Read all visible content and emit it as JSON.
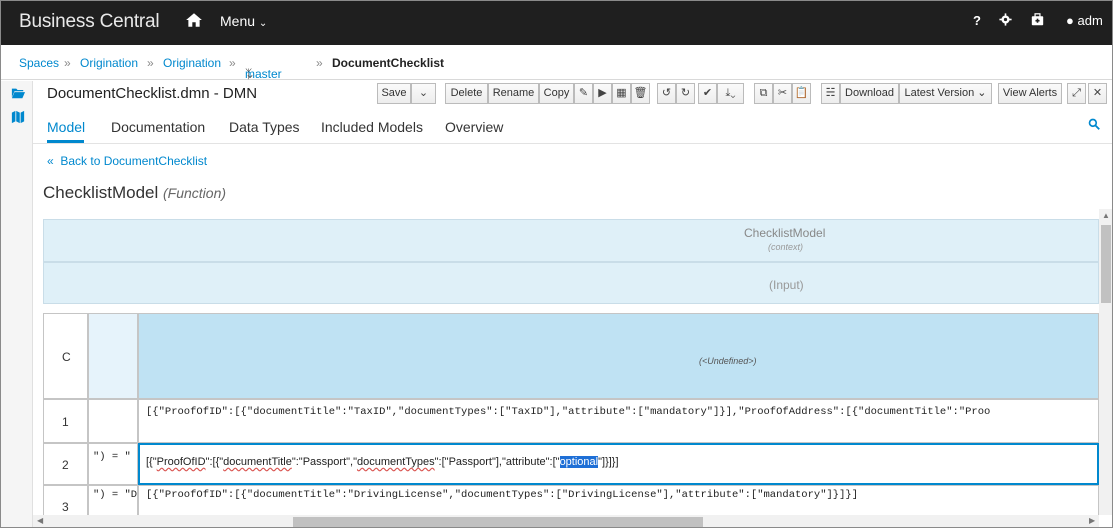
{
  "app": {
    "brand": "Business Central",
    "menu_label": "Menu",
    "help": "?",
    "user_label": "adm"
  },
  "breadcrumb": {
    "items": [
      "Spaces",
      "Origination",
      "Origination"
    ],
    "branch": "master",
    "current": "DocumentChecklist"
  },
  "editor": {
    "title": "DocumentChecklist.dmn - DMN",
    "buttons": {
      "save": "Save",
      "delete": "Delete",
      "rename": "Rename",
      "copy": "Copy",
      "download": "Download",
      "latest_version": "Latest Version",
      "view_alerts": "View Alerts"
    }
  },
  "tabs": [
    "Model",
    "Documentation",
    "Data Types",
    "Included Models",
    "Overview"
  ],
  "back_link": "Back to DocumentChecklist",
  "function": {
    "name": "ChecklistModel",
    "kind": "(Function)"
  },
  "grid": {
    "context_name": "ChecklistModel",
    "context_sub": "(context)",
    "input_label": "(Input)",
    "column_header": "C",
    "undefined_label": "(<Undefined>)",
    "rows": [
      {
        "num": "1",
        "prefix": "",
        "text": "[{\"ProofOfID\":[{\"documentTitle\":\"TaxID\",\"documentTypes\":[\"TaxID\"],\"attribute\":[\"mandatory\"]}],\"ProofOfAddress\":[{\"documentTitle\":\"Proo"
      },
      {
        "num": "2",
        "prefix": "\") = \"",
        "edit": {
          "p1": "[{\"",
          "w1": "ProofOfID",
          "p2": "\":[{\"",
          "w2": "documentTitle",
          "p3": "\":\"Passport\",\"",
          "w3": "documentTypes",
          "p4": "\":[\"Passport\"],\"attribute\":[\"",
          "w4": "optional",
          "p5": "\"]}]}]"
        }
      },
      {
        "num": "3",
        "prefix": "\") = \"D",
        "text": "[{\"ProofOfID\":[{\"documentTitle\":\"DrivingLicense\",\"documentTypes\":[\"DrivingLicense\"],\"attribute\":[\"mandatory\"]}]}]"
      }
    ]
  }
}
